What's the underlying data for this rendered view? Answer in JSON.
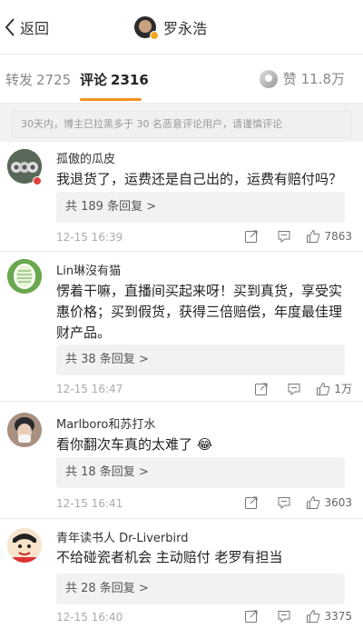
{
  "header": {
    "back_label": "返回",
    "title": "罗永浩"
  },
  "tabs": [
    {
      "label": "转发",
      "count": "2725"
    },
    {
      "label": "评论",
      "count": "2316"
    }
  ],
  "like_total": {
    "label": "赞",
    "count": "11.8万"
  },
  "notice": "30天内，博主已拉黑多于 30 名恶意评论用户，请谨慎评论",
  "comments": [
    {
      "name": "孤傲的瓜皮",
      "text": "我退货了，运费还是自己出的，运费有赔付吗？",
      "replies": "共 189 条回复 >",
      "date": "12-15 16:39",
      "likes": "7863"
    },
    {
      "name": "Lin琳沒有猫",
      "text": "愣着干嘛，直播间买起来呀！买到真货，享受实惠价格；买到假货，获得三倍赔偿，年度最佳理财产品。",
      "replies": "共 38 条回复 >",
      "date": "12-15 16:47",
      "likes": "1万"
    },
    {
      "name": "Marlboro和苏打水",
      "text": "看你翻次车真的太难了 😂",
      "replies": "共 18 条回复 >",
      "date": "12-15 16:41",
      "likes": "3603"
    },
    {
      "name": "青年读书人 Dr-Liverbird",
      "text": "不给碰瓷者机会 主动赔付 老罗有担当",
      "replies": "共 28 条回复 >",
      "date": "12-15 16:40",
      "likes": "3375"
    }
  ],
  "colors": {
    "accent": "#f7931e",
    "background": "#f2f2f2"
  }
}
